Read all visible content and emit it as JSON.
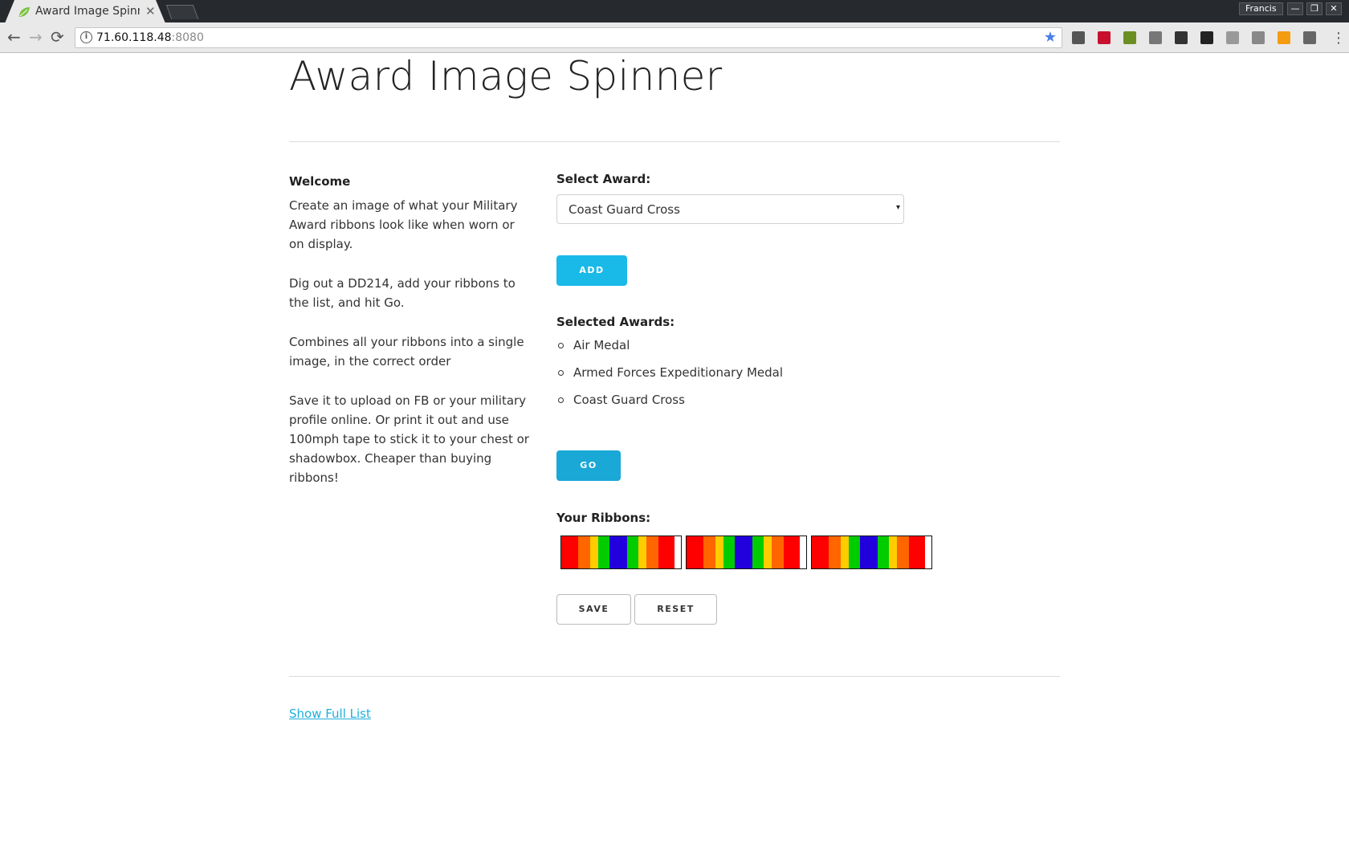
{
  "browser": {
    "tab_title": "Award Image Spinne",
    "tab_close": "✕",
    "url_host": "71.60.118.48",
    "url_port": ":8080",
    "profile": "Francis",
    "window_buttons": [
      "—",
      "❐",
      "✕"
    ],
    "nav": {
      "back": "←",
      "forward": "→",
      "reload": "⟳"
    },
    "menu": "⋮",
    "bookmark_star": "★",
    "extensions": [
      "evernote-icon",
      "adobe-icon",
      "colors-icon",
      "image-icon",
      "circle-icon",
      "m-icon",
      "puzzle-icon",
      "feed-icon",
      "rss-icon",
      "shield-icon"
    ]
  },
  "page": {
    "title": "Award Image Spinner",
    "welcome_heading": "Welcome",
    "welcome_paragraphs": [
      "Create an image of what your Military Award ribbons look like when worn or on display.",
      "Dig out a DD214, add your ribbons to the list, and hit Go.",
      "Combines all your ribbons into a single image, in the correct order",
      "Save it to upload on FB or your military profile online. Or print it out and use 100mph tape to stick it to your chest or shadowbox. Cheaper than buying ribbons!"
    ],
    "select_label": "Select Award:",
    "select_value": "Coast Guard Cross",
    "select_caret": "▾",
    "add_button": "ADD",
    "selected_label": "Selected Awards:",
    "selected_awards": [
      "Air Medal",
      "Armed Forces Expeditionary Medal",
      "Coast Guard Cross"
    ],
    "go_button": "GO",
    "ribbons_label": "Your Ribbons:",
    "ribbon_stripes": [
      "#ff0000",
      "#ff6600",
      "#ffcc00",
      "#00cc00",
      "#2200dd",
      "#00cc00",
      "#ffcc00",
      "#ff6600",
      "#ff0000"
    ],
    "ribbon_count": 3,
    "save_button": "SAVE",
    "reset_button": "RESET",
    "full_list_link": "Show Full List"
  }
}
